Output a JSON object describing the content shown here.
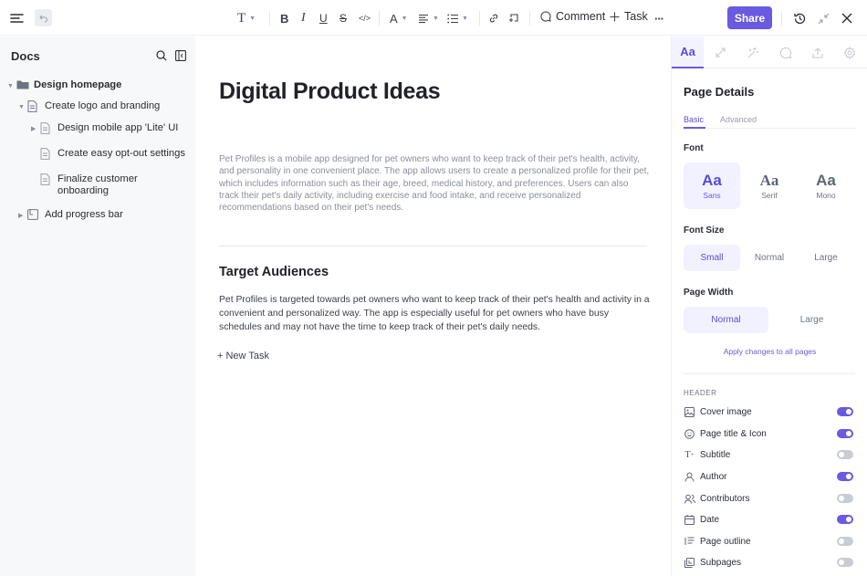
{
  "toolbar": {
    "comment_label": "Comment",
    "task_label": "Task",
    "share_label": "Share"
  },
  "sidebar": {
    "title": "Docs",
    "items": [
      {
        "label": "Design homepage",
        "level": 0,
        "expanded": true,
        "icon": "folder-icon"
      },
      {
        "label": "Create logo and branding",
        "level": 1,
        "expanded": true,
        "icon": "doc-icon"
      },
      {
        "label": "Design mobile app 'Lite' UI",
        "level": 2,
        "expanded": false,
        "icon": "doc-icon"
      },
      {
        "label": "Create easy opt-out settings",
        "level": 2,
        "icon": "doc-icon"
      },
      {
        "label": "Finalize customer onboarding",
        "level": 2,
        "icon": "doc-icon"
      },
      {
        "label": "Add progress bar",
        "level": 1,
        "expanded": false,
        "icon": "page-icon"
      }
    ]
  },
  "document": {
    "title": "Digital Product Ideas",
    "intro": "Pet Profiles is a mobile app designed for pet owners who want to keep track of their pet's health, activity, and personality in one convenient place. The app allows users to create a personalized profile for their pet, which includes information such as their age, breed, medical history, and preferences. Users can also track their pet's daily activity, including exercise and food intake, and receive personalized recommendations based on their pet's needs.",
    "section_heading": "Target Audiences",
    "section_body": "Pet Profiles is targeted towards pet owners who want to keep track of their pet's health and activity in a convenient and personalized way. The app is especially useful for pet owners who have busy schedules and may not have the time to keep track of their pet's daily needs.",
    "new_task_label": "+ New Task"
  },
  "panel": {
    "active_tab_label": "Aa",
    "title": "Page Details",
    "subtabs": {
      "basic": "Basic",
      "advanced": "Advanced"
    },
    "font": {
      "label": "Font",
      "options": [
        {
          "glyph": "Aa",
          "name": "Sans",
          "selected": true
        },
        {
          "glyph": "Aa",
          "name": "Serif",
          "selected": false
        },
        {
          "glyph": "Aa",
          "name": "Mono",
          "selected": false
        }
      ]
    },
    "font_size": {
      "label": "Font Size",
      "options": [
        "Small",
        "Normal",
        "Large"
      ],
      "selected": "Small"
    },
    "page_width": {
      "label": "Page Width",
      "options": [
        "Normal",
        "Large"
      ],
      "selected": "Normal"
    },
    "apply_link": "Apply changes to all pages",
    "header_section": "HEADER",
    "toggles": [
      {
        "label": "Cover image",
        "icon": "image-icon",
        "on": true
      },
      {
        "label": "Page title & Icon",
        "icon": "smiley-icon",
        "on": true
      },
      {
        "label": "Subtitle",
        "icon": "text-plus-icon",
        "on": false
      },
      {
        "label": "Author",
        "icon": "user-icon",
        "on": true
      },
      {
        "label": "Contributors",
        "icon": "users-icon",
        "on": false
      },
      {
        "label": "Date",
        "icon": "calendar-icon",
        "on": true
      },
      {
        "label": "Page outline",
        "icon": "outline-icon",
        "on": false
      },
      {
        "label": "Subpages",
        "icon": "subpages-icon",
        "on": false
      }
    ]
  },
  "colors": {
    "accent": "#6a5ae0",
    "accent_bg": "#f2f1ff",
    "sidebar_bg": "#f7f8f9"
  }
}
